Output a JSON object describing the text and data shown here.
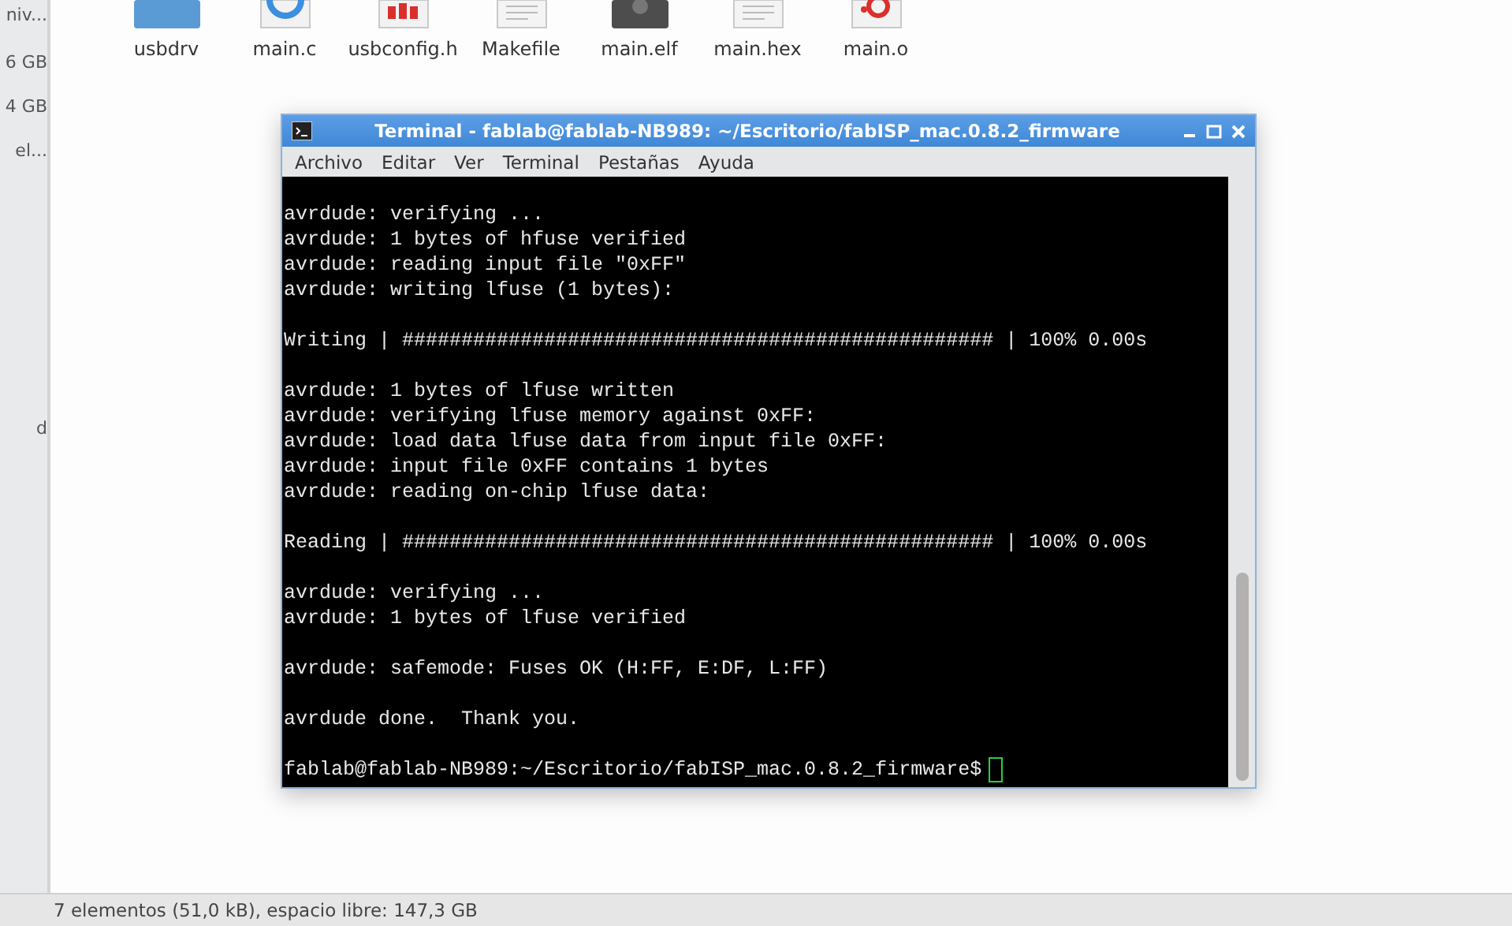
{
  "sidebar": {
    "items": [
      "niv...",
      "6 GB",
      "4 GB",
      "el...",
      "d"
    ]
  },
  "files": [
    {
      "name": "usbdrv",
      "kind": "folder"
    },
    {
      "name": "main.c",
      "kind": "source"
    },
    {
      "name": "usbconfig.h",
      "kind": "header"
    },
    {
      "name": "Makefile",
      "kind": "text"
    },
    {
      "name": "main.elf",
      "kind": "binary"
    },
    {
      "name": "main.hex",
      "kind": "text"
    },
    {
      "name": "main.o",
      "kind": "object"
    }
  ],
  "terminal": {
    "title": "Terminal - fablab@fablab-NB989: ~/Escritorio/fabISP_mac.0.8.2_firmware",
    "menu": [
      "Archivo",
      "Editar",
      "Ver",
      "Terminal",
      "Pestañas",
      "Ayuda"
    ],
    "blocks": [
      [
        "avrdude: verifying ...",
        "avrdude: 1 bytes of hfuse verified",
        "avrdude: reading input file \"0xFF\"",
        "avrdude: writing lfuse (1 bytes):"
      ],
      [
        "Writing | ################################################## | 100% 0.00s"
      ],
      [
        "avrdude: 1 bytes of lfuse written",
        "avrdude: verifying lfuse memory against 0xFF:",
        "avrdude: load data lfuse data from input file 0xFF:",
        "avrdude: input file 0xFF contains 1 bytes",
        "avrdude: reading on-chip lfuse data:"
      ],
      [
        "Reading | ################################################## | 100% 0.00s"
      ],
      [
        "avrdude: verifying ...",
        "avrdude: 1 bytes of lfuse verified"
      ],
      [
        "avrdude: safemode: Fuses OK (H:FF, E:DF, L:FF)"
      ],
      [
        "avrdude done.  Thank you."
      ]
    ],
    "prompt": "fablab@fablab-NB989:~/Escritorio/fabISP_mac.0.8.2_firmware$"
  },
  "status_bar": "7 elementos (51,0 kB), espacio libre: 147,3 GB"
}
